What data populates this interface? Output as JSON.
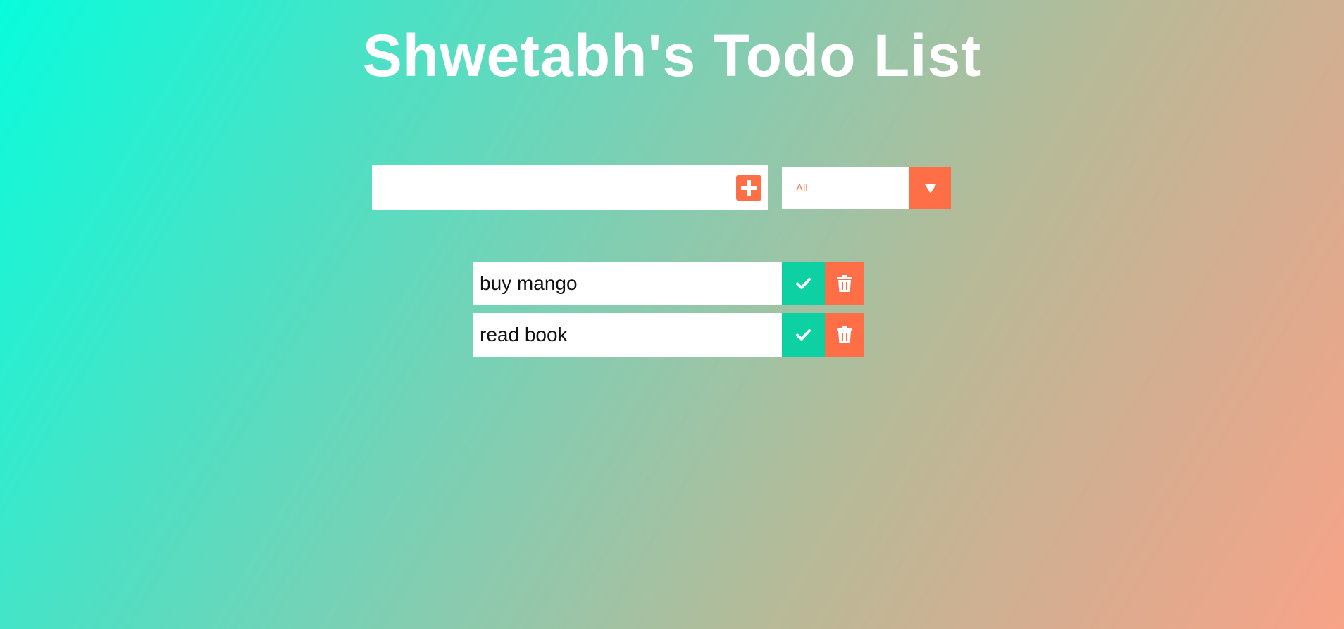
{
  "header": {
    "title": "Shwetabh's Todo List"
  },
  "form": {
    "input_value": "",
    "input_placeholder": "",
    "add_icon": "plus-square-icon",
    "filter": {
      "selected": "All",
      "arrow_icon": "caret-down-icon"
    }
  },
  "todos": [
    {
      "text": "buy mango",
      "complete_icon": "check-icon",
      "delete_icon": "trash-icon"
    },
    {
      "text": "read book",
      "complete_icon": "check-icon",
      "delete_icon": "trash-icon"
    }
  ],
  "colors": {
    "accent": "#ff6f47",
    "complete": "#0dd1a3",
    "background_start": "#08fcdc",
    "background_end": "#f8a388",
    "title": "#ffffff"
  }
}
